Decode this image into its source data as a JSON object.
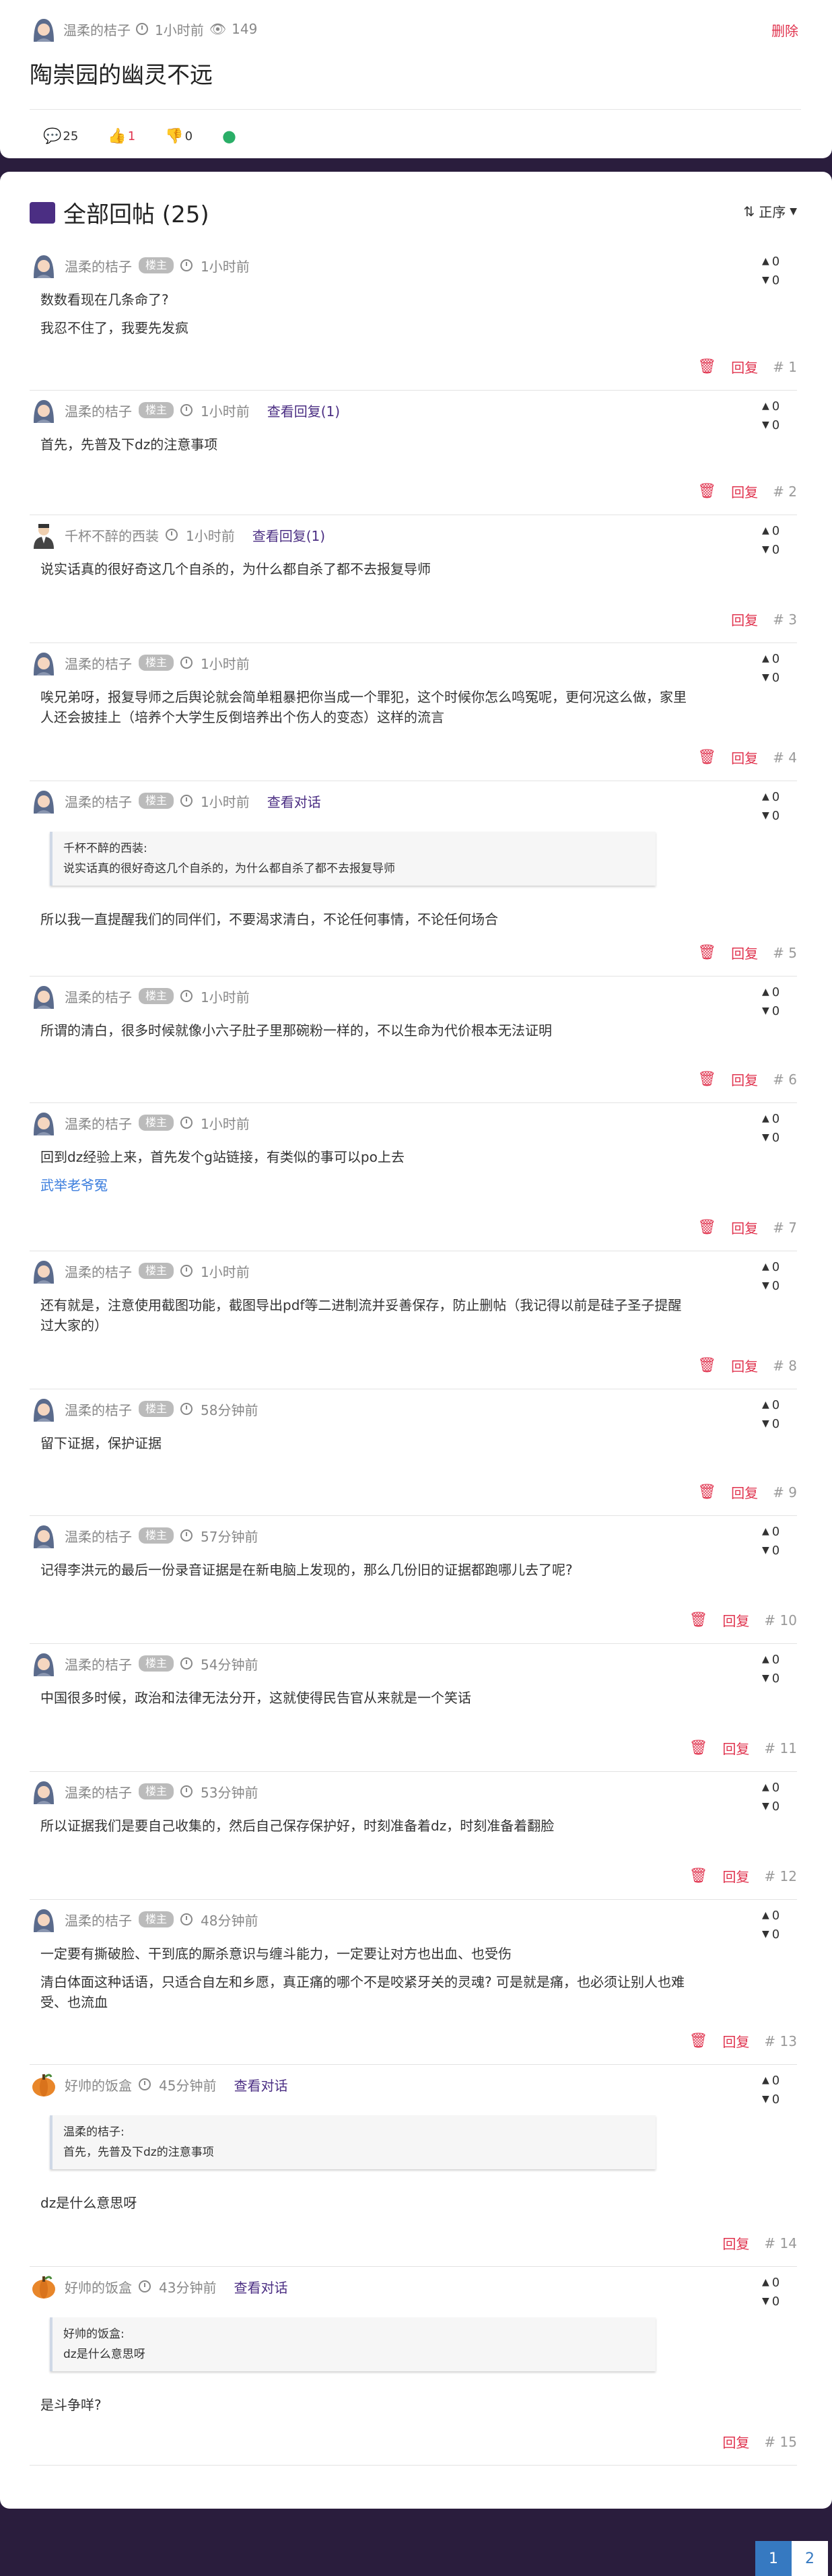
{
  "topic": {
    "author": "温柔的桔子",
    "time": "1小时前",
    "views": "149",
    "delete_label": "删除",
    "title": "陶崇园的幽灵不远",
    "stats": {
      "comments": "25",
      "likes": "1",
      "dislikes": "0"
    }
  },
  "replies_header": {
    "title": "全部回帖 (25)",
    "sort_label": "正序"
  },
  "labels": {
    "op_badge": "楼主",
    "reply": "回复",
    "view_replies": "查看回复(1)",
    "view_dialog": "查看对话"
  },
  "posts": [
    {
      "author": "温柔的桔子",
      "op": true,
      "time": "1小时前",
      "lines": [
        "数数看现在几条命了?",
        "我忍不住了，我要先发疯"
      ],
      "up": "0",
      "down": "0",
      "floor": "# 1",
      "deletable": true
    },
    {
      "author": "温柔的桔子",
      "op": true,
      "time": "1小时前",
      "extra": "查看回复(1)",
      "lines": [
        "首先，先普及下dz的注意事项"
      ],
      "up": "0",
      "down": "0",
      "floor": "# 2",
      "deletable": true
    },
    {
      "author": "千杯不醉的西装",
      "op": false,
      "time": "1小时前",
      "extra": "查看回复(1)",
      "lines": [
        "说实话真的很好奇这几个自杀的，为什么都自杀了都不去报复导师"
      ],
      "up": "0",
      "down": "0",
      "floor": "# 3",
      "deletable": false
    },
    {
      "author": "温柔的桔子",
      "op": true,
      "time": "1小时前",
      "lines": [
        "唉兄弟呀，报复导师之后舆论就会简单粗暴把你当成一个罪犯，这个时候你怎么鸣冤呢，更何况这么做，家里人还会披挂上（培养个大学生反倒培养出个伤人的变态）这样的流言"
      ],
      "up": "0",
      "down": "0",
      "floor": "# 4",
      "deletable": true
    },
    {
      "author": "温柔的桔子",
      "op": true,
      "time": "1小时前",
      "extra": "查看对话",
      "quote_author": "千杯不醉的西装:",
      "quote_text": "说实话真的很好奇这几个自杀的，为什么都自杀了都不去报复导师",
      "lines": [
        "所以我一直提醒我们的同伴们，不要渴求清白，不论任何事情，不论任何场合"
      ],
      "up": "0",
      "down": "0",
      "floor": "# 5",
      "deletable": true
    },
    {
      "author": "温柔的桔子",
      "op": true,
      "time": "1小时前",
      "lines": [
        "所谓的清白，很多时候就像小六子肚子里那碗粉一样的，不以生命为代价根本无法证明"
      ],
      "up": "0",
      "down": "0",
      "floor": "# 6",
      "deletable": true
    },
    {
      "author": "温柔的桔子",
      "op": true,
      "time": "1小时前",
      "lines": [
        "回到dz经验上来，首先发个g站链接，有类似的事可以po上去"
      ],
      "link": "武举老爷冤",
      "up": "0",
      "down": "0",
      "floor": "# 7",
      "deletable": true
    },
    {
      "author": "温柔的桔子",
      "op": true,
      "time": "1小时前",
      "lines": [
        "还有就是，注意使用截图功能，截图导出pdf等二进制流并妥善保存，防止删帖（我记得以前是硅子圣子提醒过大家的）"
      ],
      "up": "0",
      "down": "0",
      "floor": "# 8",
      "deletable": true
    },
    {
      "author": "温柔的桔子",
      "op": true,
      "time": "58分钟前",
      "lines": [
        "留下证据，保护证据"
      ],
      "up": "0",
      "down": "0",
      "floor": "# 9",
      "deletable": true
    },
    {
      "author": "温柔的桔子",
      "op": true,
      "time": "57分钟前",
      "lines": [
        "记得李洪元的最后一份录音证据是在新电脑上发现的，那么几份旧的证据都跑哪儿去了呢?"
      ],
      "up": "0",
      "down": "0",
      "floor": "# 10",
      "deletable": true
    },
    {
      "author": "温柔的桔子",
      "op": true,
      "time": "54分钟前",
      "lines": [
        "中国很多时候，政治和法律无法分开，这就使得民告官从来就是一个笑话"
      ],
      "up": "0",
      "down": "0",
      "floor": "# 11",
      "deletable": true
    },
    {
      "author": "温柔的桔子",
      "op": true,
      "time": "53分钟前",
      "lines": [
        "所以证据我们是要自己收集的，然后自己保存保护好，时刻准备着dz，时刻准备着翻脸"
      ],
      "up": "0",
      "down": "0",
      "floor": "# 12",
      "deletable": true
    },
    {
      "author": "温柔的桔子",
      "op": true,
      "time": "48分钟前",
      "lines": [
        "一定要有撕破脸、干到底的厮杀意识与缠斗能力，一定要让对方也出血、也受伤",
        "清白体面这种话语，只适合自左和乡愿，真正痛的哪个不是咬紧牙关的灵魂? 可是就是痛，也必须让别人也难受、也流血"
      ],
      "up": "0",
      "down": "0",
      "floor": "# 13",
      "deletable": true
    },
    {
      "author": "好帅的饭盒",
      "op": false,
      "time": "45分钟前",
      "extra": "查看对话",
      "quote_author": "温柔的桔子:",
      "quote_text": "首先，先普及下dz的注意事项",
      "lines": [
        "dz是什么意思呀"
      ],
      "up": "0",
      "down": "0",
      "floor": "# 14",
      "deletable": false
    },
    {
      "author": "好帅的饭盒",
      "op": false,
      "time": "43分钟前",
      "extra": "查看对话",
      "quote_author": "好帅的饭盒:",
      "quote_text": "dz是什么意思呀",
      "lines": [
        "是斗争咩?"
      ],
      "up": "0",
      "down": "0",
      "floor": "# 15",
      "deletable": false
    }
  ],
  "pagination": {
    "pages": [
      "1",
      "2"
    ],
    "current": "1"
  },
  "colors": {
    "accent": "#4b2e83",
    "danger": "#e0334e",
    "background": "#2a1d3d",
    "pager_active": "#3679c1"
  },
  "icons": {
    "comment": "comment-icon",
    "like": "thumbs-up-icon",
    "dislike": "thumbs-down-icon",
    "wechat": "wechat-icon",
    "sort": "sort-icon",
    "trash": "trash-icon"
  }
}
